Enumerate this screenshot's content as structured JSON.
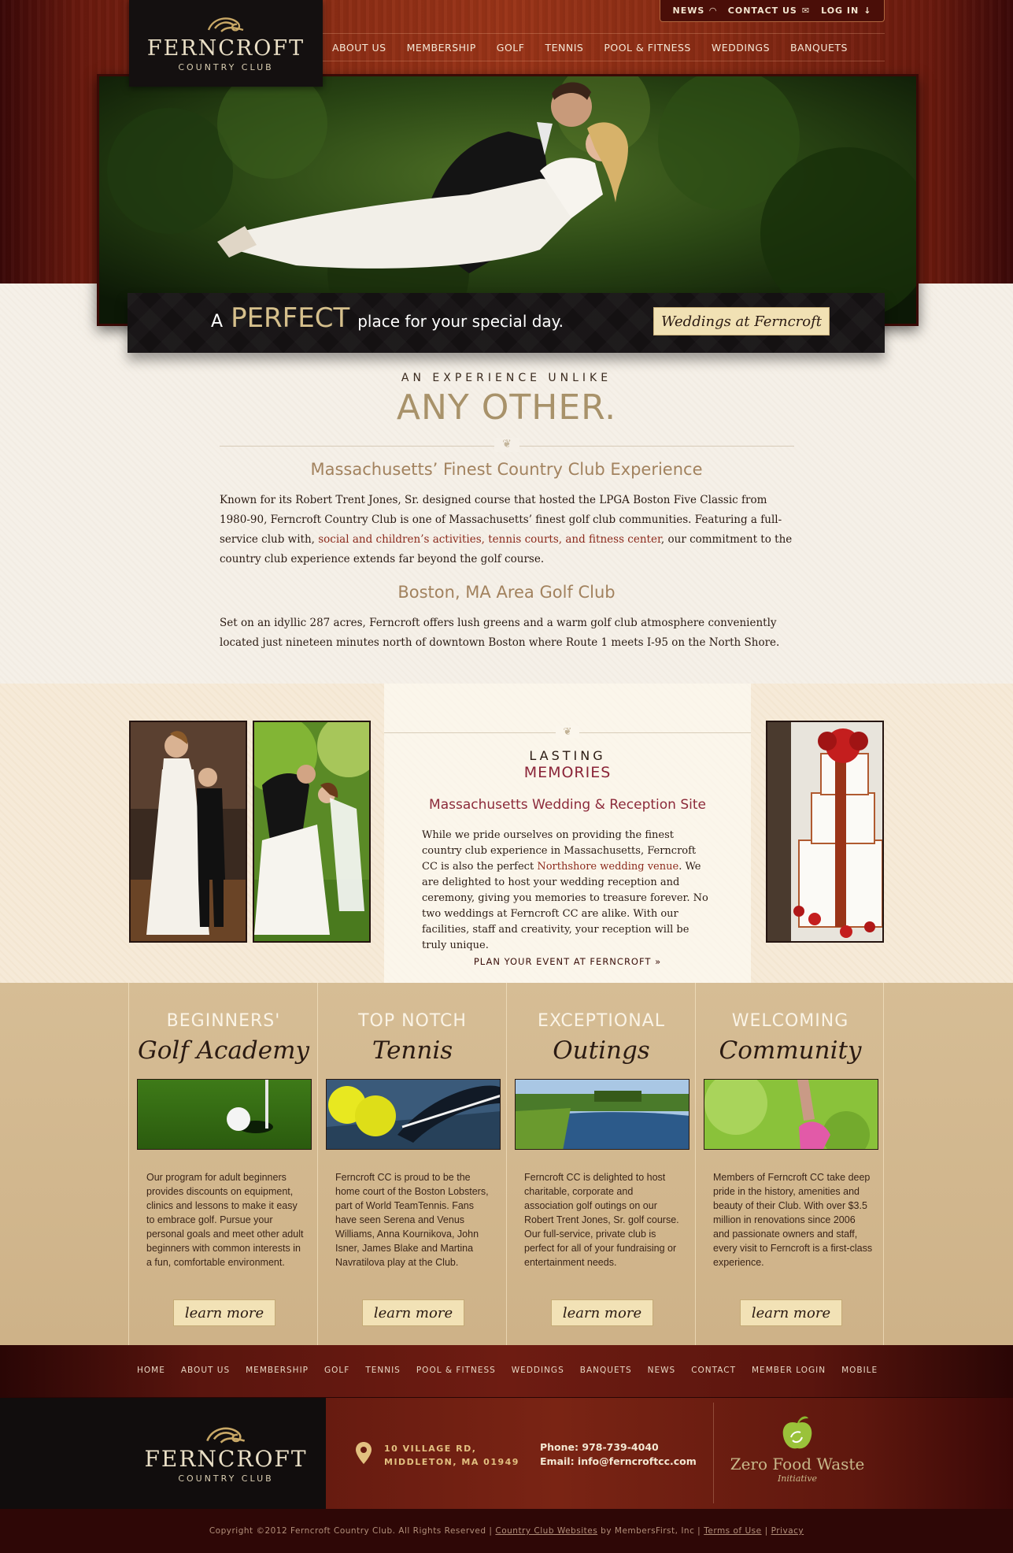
{
  "logo": {
    "name": "Ferncroft",
    "sub": "Country Club"
  },
  "util_nav": [
    {
      "label": "NEWS",
      "icon": "rss-icon",
      "glyph": "◠"
    },
    {
      "label": "CONTACT US",
      "icon": "mail-icon",
      "glyph": "✉"
    },
    {
      "label": "LOG IN",
      "icon": "arrow-down-icon",
      "glyph": "↓"
    }
  ],
  "main_nav": [
    "ABOUT US",
    "MEMBERSHIP",
    "GOLF",
    "TENNIS",
    "POOL & FITNESS",
    "WEDDINGS",
    "BANQUETS"
  ],
  "banner": {
    "a": "A",
    "perfect": "PERFECT",
    "rest": "place for your special day.",
    "button": "Weddings at Ferncroft"
  },
  "intro": {
    "kicker": "AN EXPERIENCE UNLIKE",
    "headline": "ANY OTHER.",
    "h1": "Massachusetts’ Finest Country Club Experience",
    "p1_a": "Known for its Robert Trent Jones, Sr. designed course that hosted the LPGA Boston Five Classic from 1980-90, Ferncroft Country Club is one of Massachusetts’ finest golf club communities. Featuring a full-service club with, ",
    "p1_link": "social and children’s activities, tennis courts, and fitness center",
    "p1_b": ", our commitment to the country club experience extends far beyond the golf course.",
    "h2": "Boston, MA Area Golf Club",
    "p2": "Set on an idyllic 287 acres, Ferncroft offers lush greens and a warm golf club atmosphere conveniently located just nineteen minutes north of downtown Boston where Route 1 meets I-95 on the North Shore."
  },
  "memories": {
    "k1": "LASTING",
    "k2": "MEMORIES",
    "h": "Massachusetts Wedding & Reception Site",
    "p_a": "While we pride ourselves on providing the finest country club experience in Massachusetts, Ferncroft CC is also the perfect ",
    "p_link": "Northshore wedding venue",
    "p_b": ".  We are delighted to host your wedding reception and ceremony, giving you memories to treasure forever.  No two weddings at Ferncroft CC are alike.  With our facilities, staff and creativity, your reception will be truly unique.",
    "cta": "PLAN YOUR EVENT AT FERNCROFT »"
  },
  "features": [
    {
      "k": "BEGINNERS'",
      "t": "Golf Academy",
      "p": "Our program for adult beginners provides discounts on equipment, clinics and lessons to make it easy to embrace golf. Pursue your personal goals and meet other adult beginners with common interests in a fun, comfortable environment.",
      "btn": "learn more"
    },
    {
      "k": "TOP NOTCH",
      "t": "Tennis",
      "p": "Ferncroft CC is proud to be the home court of the Boston Lobsters, part of World TeamTennis. Fans have seen Serena and Venus Williams, Anna Kournikova, John Isner, James Blake and Martina Navratilova play at the Club.",
      "btn": "learn more"
    },
    {
      "k": "EXCEPTIONAL",
      "t": "Outings",
      "p": "Ferncroft CC is delighted to host charitable, corporate and association golf outings on our Robert Trent Jones, Sr. golf course. Our full-service, private club is perfect for all of your fundraising or entertainment needs.",
      "btn": "learn more"
    },
    {
      "k": "WELCOMING",
      "t": "Community",
      "p": "Members of Ferncroft CC take deep pride in the history, amenities and beauty of their Club. With over $3.5 million in renovations since 2006 and passionate owners and staff, every visit to Ferncroft is a first-class experience.",
      "btn": "learn more"
    }
  ],
  "footer_nav": [
    "HOME",
    "ABOUT US",
    "MEMBERSHIP",
    "GOLF",
    "TENNIS",
    "POOL & FITNESS",
    "WEDDINGS",
    "BANQUETS",
    "NEWS",
    "CONTACT",
    "MEMBER LOGIN",
    "MOBILE"
  ],
  "footer": {
    "addr1": "10 VILLAGE RD,",
    "addr2": "MIDDLETON, MA 01949",
    "phone": "Phone: 978-739-4040",
    "email": "Email: info@ferncroftcc.com",
    "zfw_title": "Zero Food Waste",
    "zfw_sub": "Initiative"
  },
  "copyright": {
    "a": "Copyright ©2012 Ferncroft Country Club. All Rights Reserved |",
    "link1": "Country Club Websites",
    "b": "by MembersFirst, Inc |",
    "link2": "Terms of Use",
    "sep": "|",
    "link3": "Privacy"
  }
}
